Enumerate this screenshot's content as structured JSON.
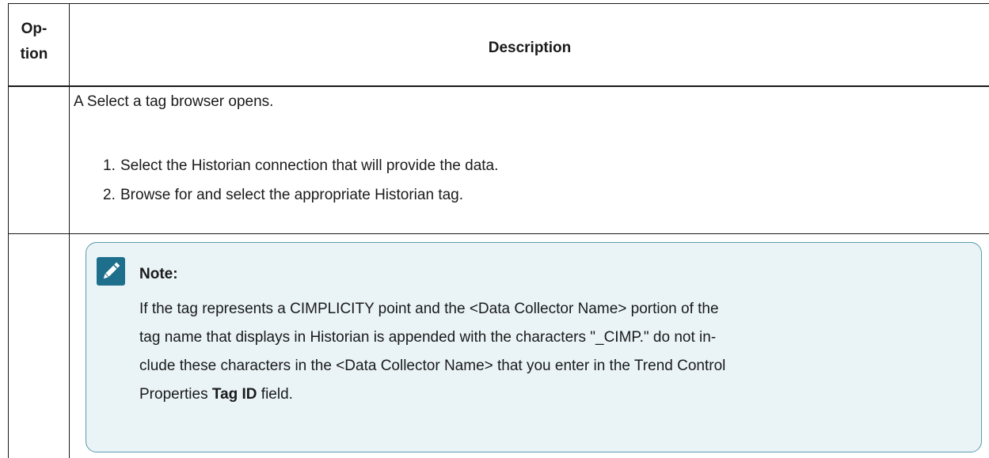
{
  "table": {
    "headers": {
      "option_line1": "Op-",
      "option_line2": "tion",
      "description": "Description"
    },
    "row1": {
      "intro": "A Select a tag browser opens.",
      "steps": [
        {
          "number": "1.",
          "text": "Select the Historian connection that will provide the data."
        },
        {
          "number": "2.",
          "text": "Browse for and select the appropriate Historian tag."
        }
      ]
    },
    "row2": {
      "note": {
        "icon": "pencil-icon",
        "title": "Note:",
        "line1": "If the tag represents a CIMPLICITY point and the <Data Collector Name> portion of the",
        "line2": "tag name that displays in Historian is appended with the characters \"_CIMP.\" do not in-",
        "line3": "clude these characters in the <Data Collector Name> that you enter in the Trend Control",
        "line4_prefix": "Properties ",
        "line4_bold": "Tag ID",
        "line4_suffix": " field."
      }
    }
  },
  "colors": {
    "note_border": "#5b9bb0",
    "note_background": "#eaf4f7",
    "icon_background": "#1d6f8c"
  }
}
